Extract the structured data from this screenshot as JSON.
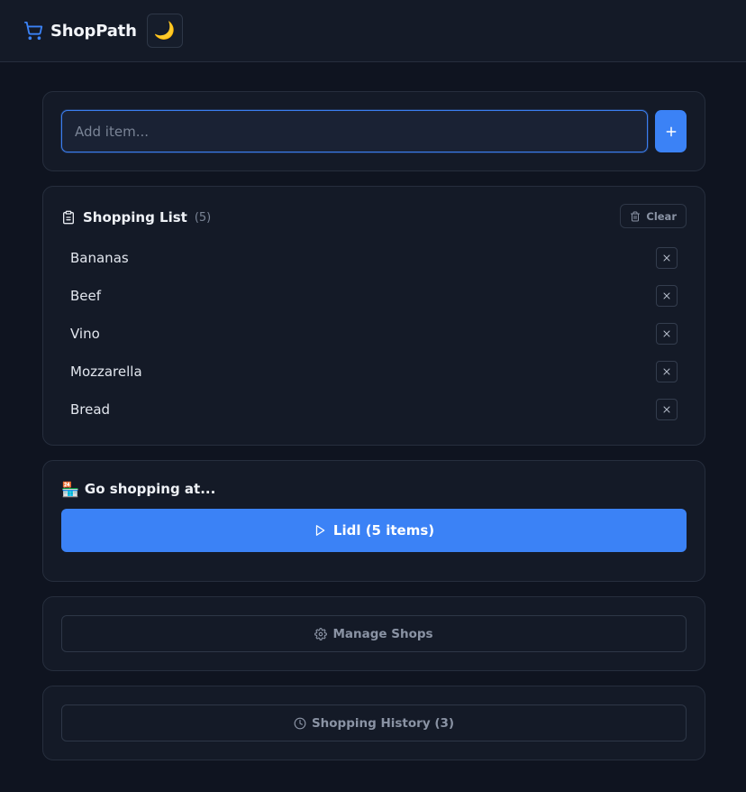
{
  "header": {
    "app_name": "ShopPath",
    "logo_icon": "shopping-cart-icon",
    "theme_toggle_icon": "🌙",
    "accent_color": "#3b82f6"
  },
  "add_item": {
    "placeholder": "Add item...",
    "value": "",
    "button_icon": "+"
  },
  "shopping_list": {
    "title": "Shopping List",
    "count": "(5)",
    "clear_label": "Clear",
    "items": [
      {
        "label": "Bananas"
      },
      {
        "label": "Beef"
      },
      {
        "label": "Vino"
      },
      {
        "label": "Mozzarella"
      },
      {
        "label": "Bread"
      }
    ]
  },
  "go_shopping": {
    "emoji": "🏪",
    "title": "Go shopping at...",
    "shop_button_label": "Lidl (5 items)"
  },
  "manage_shops": {
    "label": "Manage Shops"
  },
  "history": {
    "label": "Shopping History (3)"
  }
}
